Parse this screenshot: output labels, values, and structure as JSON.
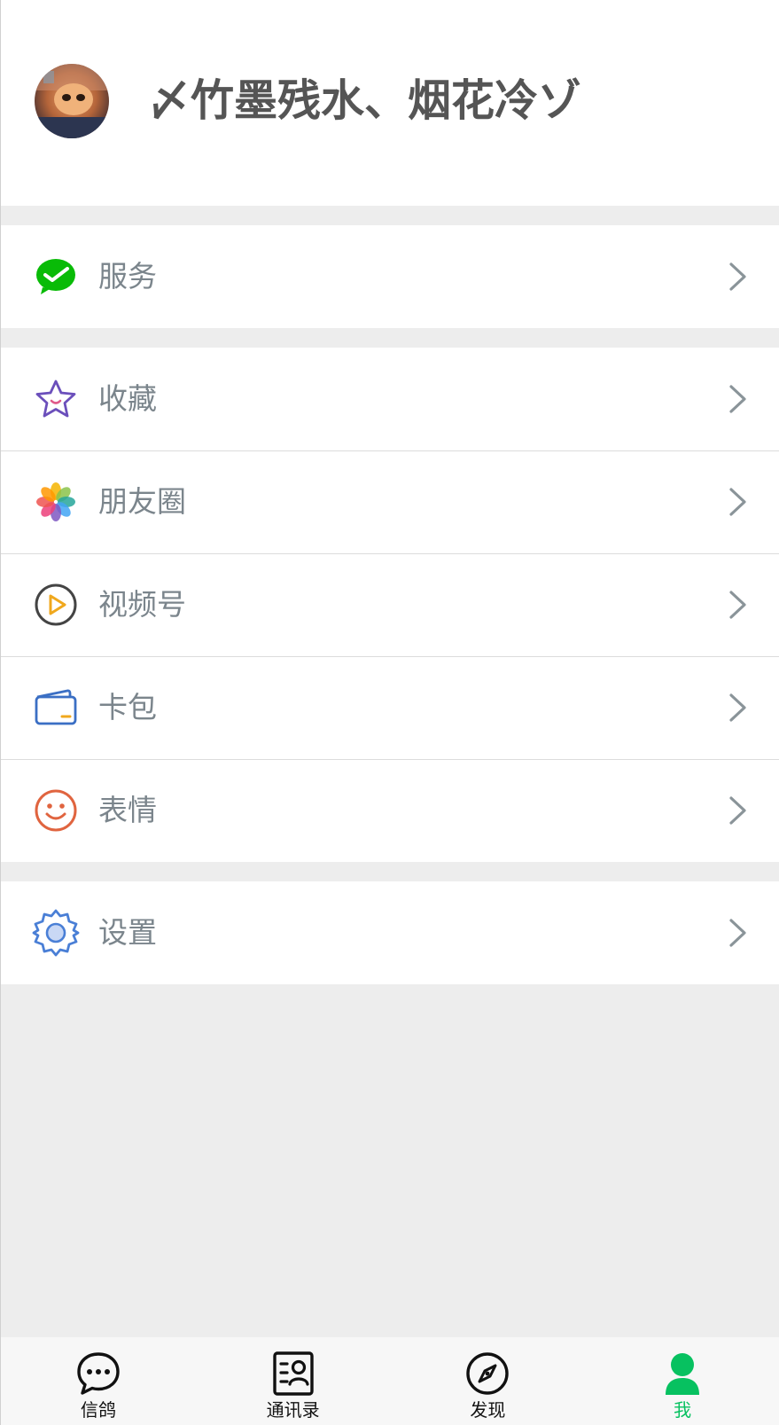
{
  "profile": {
    "nickname": "〆竹墨残水、烟花冷ゾ",
    "avatar": "avatar-photo"
  },
  "menu": {
    "service": {
      "label": "服务",
      "icon": "wechat-pay-icon",
      "color": "#09bb07"
    },
    "favorites": {
      "label": "收藏",
      "icon": "star-icon",
      "color": "#6b4fbb"
    },
    "moments": {
      "label": "朋友圈",
      "icon": "album-flower-icon"
    },
    "channels": {
      "label": "视频号",
      "icon": "video-channel-icon",
      "color": "#f0a81d"
    },
    "cards": {
      "label": "卡包",
      "icon": "wallet-icon",
      "color": "#3b6fc4"
    },
    "stickers": {
      "label": "表情",
      "icon": "smiley-icon",
      "color": "#e0643f"
    },
    "settings": {
      "label": "设置",
      "icon": "gear-icon",
      "color": "#4a7fd6"
    }
  },
  "tabbar": {
    "chats": {
      "label": "信鸽",
      "icon": "chat-bubble-icon"
    },
    "contacts": {
      "label": "通讯录",
      "icon": "contacts-book-icon"
    },
    "discover": {
      "label": "发现",
      "icon": "compass-icon"
    },
    "me": {
      "label": "我",
      "icon": "person-icon",
      "active": true,
      "color": "#07c160"
    }
  }
}
